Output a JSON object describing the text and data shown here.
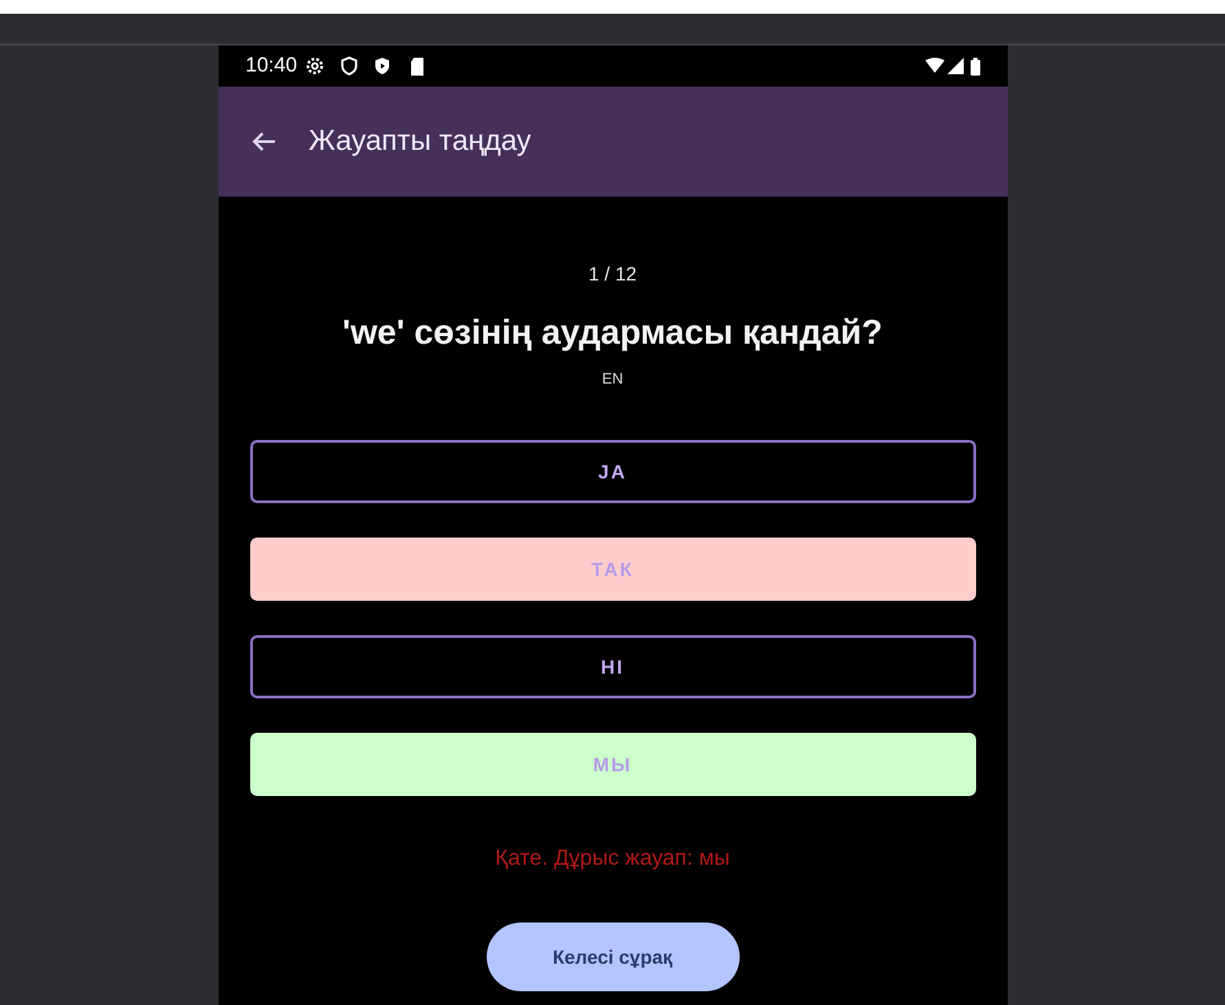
{
  "status_bar": {
    "time": "10:40"
  },
  "app_bar": {
    "title": "Жауапты таңдау"
  },
  "quiz": {
    "progress": "1 / 12",
    "question": "'we' сөзінің аудармасы қандай?",
    "language": "EN",
    "options": [
      {
        "label": "JA",
        "kind": "plain"
      },
      {
        "label": "ТАК",
        "kind": "wrong"
      },
      {
        "label": "НІ",
        "kind": "plain"
      },
      {
        "label": "МЫ",
        "kind": "correct"
      }
    ],
    "feedback": "Қате. Дұрыс жауап: мы",
    "next_button": "Келесі сұрақ"
  }
}
